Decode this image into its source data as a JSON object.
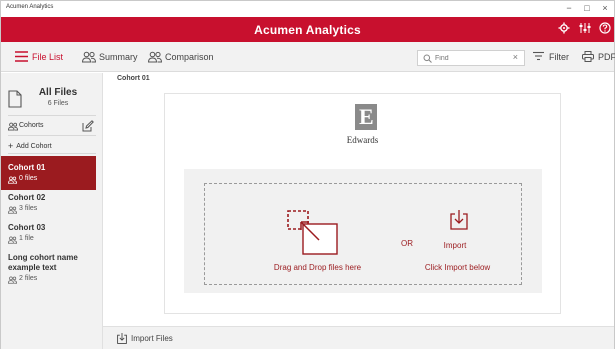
{
  "window": {
    "title": "Acumen Analytics",
    "controls": [
      "−",
      "□",
      "×"
    ]
  },
  "header": {
    "title": "Acumen Analytics",
    "accent": "#c8102e"
  },
  "toolbar": {
    "tabs": [
      {
        "label": "File List",
        "icon": "list-icon",
        "active": true
      },
      {
        "label": "Summary",
        "icon": "people-icon",
        "active": false
      },
      {
        "label": "Comparison",
        "icon": "people-icon",
        "active": false
      }
    ],
    "search": {
      "placeholder": "Find"
    },
    "filter_label": "Filter",
    "pdf_label": "PDF"
  },
  "sidebar": {
    "all_files": {
      "title": "All Files",
      "count": "6 Files"
    },
    "cohorts_label": "Cohorts",
    "add_cohort": "Add Cohort",
    "cohorts": [
      {
        "name": "Cohort 01",
        "files": "0 files",
        "active": true
      },
      {
        "name": "Cohort 02",
        "files": "3 files",
        "active": false
      },
      {
        "name": "Cohort 03",
        "files": "1 file",
        "active": false
      },
      {
        "name": "Long cohort name example text",
        "files": "2 files",
        "active": false
      }
    ],
    "active_color": "#9b1b1f"
  },
  "main": {
    "breadcrumb": "Cohort 01",
    "brand": "Edwards",
    "logo_letter": "E",
    "drag_text": "Drag and Drop files here",
    "or_text": "OR",
    "import_label": "Import",
    "import_text": "Click Import below"
  },
  "footer": {
    "import_files": "Import Files"
  }
}
